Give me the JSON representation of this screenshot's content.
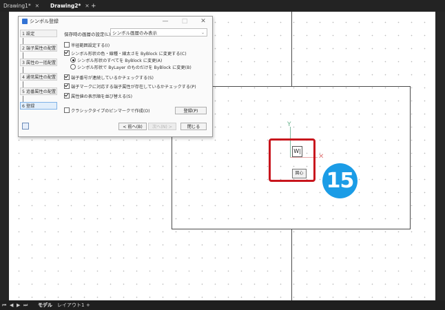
{
  "tabs": [
    {
      "label": "Drawing1*",
      "close": "✕"
    },
    {
      "label": "Drawing2*",
      "close": "✕"
    }
  ],
  "tab_add": "+",
  "dialog": {
    "title": "シンボル登録",
    "controls": {
      "minimize": "—",
      "maximize": "□",
      "close": "✕"
    },
    "sidebar": [
      {
        "label": "1 設定"
      },
      {
        "label": "2 端子属性の配置"
      },
      {
        "label": "3 属性の一括配置"
      },
      {
        "label": "4 通常属性の配置"
      },
      {
        "label": "5 追番属性の配置"
      },
      {
        "label": "6 登録"
      }
    ],
    "save_layer_label": "保存時の画層の設定(L)",
    "save_layer_value": "シンボル画層のみ表示",
    "options": {
      "half_range": "半径範囲設定する(I)",
      "change_color": "シンボル形状の色・線種・線太さを ByBlock に変更する(C)",
      "radio_all": "シンボル形状のすべてを ByBlock に変更(A)",
      "radio_bylayer": "シンボル形状で ByLayer のものだけを ByBlock に変更(B)",
      "check_terminal_num": "端子番号が連続しているかチェックする(S)",
      "check_terminal_mark": "端子マークに対応する端子属性が存在しているかチェックする(P)",
      "sort_attr": "属性値の表示順を並び替える(S)",
      "classic_pinmark": "クラシックタイプのピンマークで作成(O)"
    },
    "buttons": {
      "register": "登録(P)",
      "back": "< 前へ(B)",
      "next": "次へ(N) >",
      "close": "閉じる"
    }
  },
  "canvas": {
    "axis_y_label": "Y",
    "axis_x_label": "✕",
    "text_entry": "W|",
    "tooltip": "図心",
    "step_badge": "15"
  },
  "bottom": {
    "nav": [
      "⏮",
      "◀",
      "▶",
      "⏭"
    ],
    "model_tab": "モデル",
    "layout_tab": "レイアウト1",
    "add": "+"
  },
  "colors": {
    "badge": "#1b9ce6",
    "highlight": "#c8151d",
    "active_step": "#e1eefb"
  }
}
